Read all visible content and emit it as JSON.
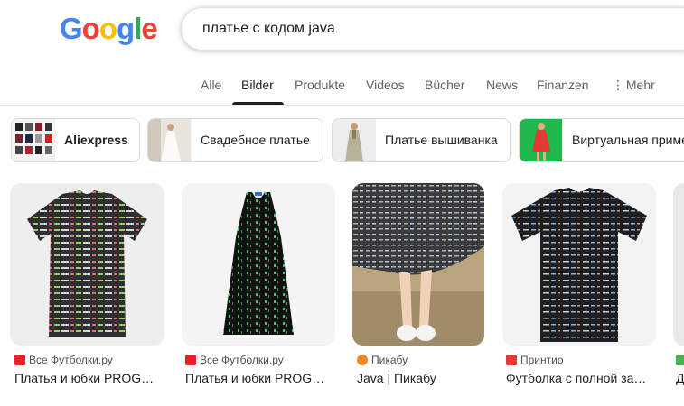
{
  "logo": {
    "letters": [
      "G",
      "o",
      "o",
      "g",
      "l",
      "e"
    ],
    "colors": [
      "#4285F4",
      "#EA4335",
      "#FBBC05",
      "#4285F4",
      "#34A853",
      "#EA4335"
    ]
  },
  "search": {
    "query": "платье с кодом java"
  },
  "tabs": [
    {
      "label": "Alle"
    },
    {
      "label": "Bilder",
      "active": true
    },
    {
      "label": "Produkte"
    },
    {
      "label": "Videos"
    },
    {
      "label": "Bücher"
    },
    {
      "label": "News"
    },
    {
      "label": "Finanzen"
    },
    {
      "label": "Mehr",
      "icon": "more-vert-icon"
    }
  ],
  "chips": [
    {
      "label": "Aliexpress"
    },
    {
      "label": "Свадебное платье"
    },
    {
      "label": "Платье вышиванка"
    },
    {
      "label": "Виртуальная примерка"
    }
  ],
  "results": [
    {
      "source": "Все Футболки.ру",
      "title": "Платья и юбки PROG…",
      "favicon_color": "#e8202a"
    },
    {
      "source": "Все Футболки.ру",
      "title": "Платья и юбки PROG…",
      "favicon_color": "#e8202a"
    },
    {
      "source": "Пикабу",
      "title": "Java | Пикабу",
      "favicon_color": "#f08a24"
    },
    {
      "source": "Принтио",
      "title": "Футболка с полной за…",
      "favicon_color": "#e53935"
    },
    {
      "source": "",
      "title": "Д",
      "favicon_color": "#4caf50"
    }
  ],
  "colors": {
    "accent": "#202124",
    "muted": "#5f6368"
  }
}
